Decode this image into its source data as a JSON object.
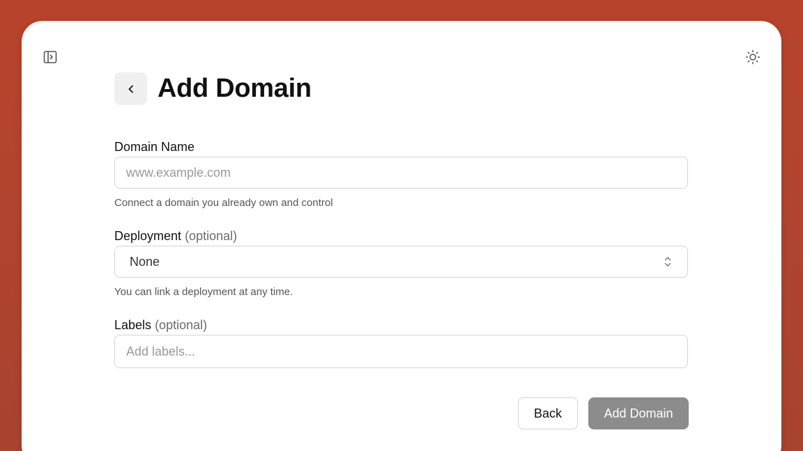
{
  "header": {
    "title": "Add Domain",
    "sidebar_toggle_icon": "sidebar-panel-icon",
    "theme_toggle_icon": "sun-icon",
    "back_icon": "chevron-left-icon"
  },
  "form": {
    "domain_name": {
      "label": "Domain Name",
      "value": "",
      "placeholder": "www.example.com",
      "helper": "Connect a domain you already own and control"
    },
    "deployment": {
      "label": "Deployment",
      "optional_text": "(optional)",
      "selected": "None",
      "helper": "You can link a deployment at any time.",
      "icon": "chevron-up-down-icon"
    },
    "labels": {
      "label": "Labels",
      "optional_text": "(optional)",
      "value": "",
      "placeholder": "Add labels..."
    }
  },
  "actions": {
    "back_label": "Back",
    "submit_label": "Add Domain"
  },
  "colors": {
    "background": "#b0442f",
    "window": "#ffffff",
    "submit_button": "#8c8c8c",
    "border": "#d4d4d4"
  }
}
